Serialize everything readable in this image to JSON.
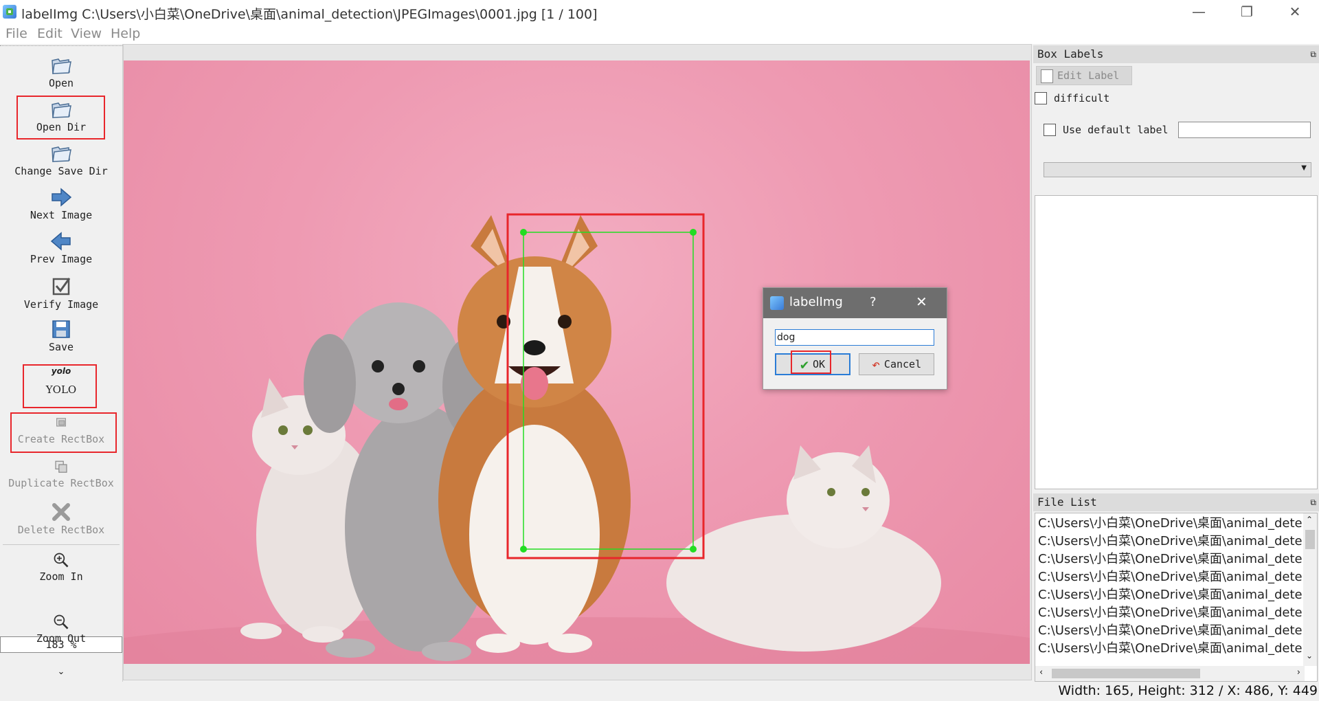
{
  "window": {
    "title": "labelImg C:\\Users\\小白菜\\OneDrive\\桌面\\animal_detection\\JPEGImages\\0001.jpg [1 / 100]",
    "minimize_glyph": "—",
    "maximize_glyph": "❐",
    "close_glyph": "✕"
  },
  "menu": [
    "File",
    "Edit",
    "View",
    "Help"
  ],
  "toolbar": {
    "open": "Open",
    "open_dir": "Open Dir",
    "change_save_dir": "Change Save Dir",
    "next_image": "Next Image",
    "prev_image": "Prev Image",
    "verify_image": "Verify Image",
    "save": "Save",
    "format_icon_text": "yolo",
    "format": "YOLO",
    "create_rectbox": "Create RectBox",
    "duplicate_rectbox": "Duplicate RectBox",
    "delete_rectbox": "Delete RectBox",
    "zoom_in": "Zoom In",
    "zoom_value": "183 %",
    "zoom_out": "Zoom Out",
    "more_glyph": "⌄"
  },
  "box_labels": {
    "title": "Box Labels",
    "edit_label": "Edit Label",
    "difficult": "difficult",
    "use_default_label": "Use default label",
    "default_label_value": ""
  },
  "file_list": {
    "title": "File List",
    "items": [
      "C:\\Users\\小白菜\\OneDrive\\桌面\\animal_detec",
      "C:\\Users\\小白菜\\OneDrive\\桌面\\animal_detec",
      "C:\\Users\\小白菜\\OneDrive\\桌面\\animal_detec",
      "C:\\Users\\小白菜\\OneDrive\\桌面\\animal_detec",
      "C:\\Users\\小白菜\\OneDrive\\桌面\\animal_detec",
      "C:\\Users\\小白菜\\OneDrive\\桌面\\animal_detec",
      "C:\\Users\\小白菜\\OneDrive\\桌面\\animal_detec",
      "C:\\Users\\小白菜\\OneDrive\\桌面\\animal_detec"
    ]
  },
  "dialog": {
    "title": "labelImg",
    "help": "?",
    "close": "✕",
    "input_value": "dog",
    "ok": "OK",
    "cancel": "Cancel"
  },
  "status": {
    "text": "Width: 165, Height: 312 / X: 486, Y: 449"
  },
  "colors": {
    "highlight_red": "#e8262b",
    "bbox_green": "#22dd22",
    "canvas_pink": "#ee9ab2"
  }
}
